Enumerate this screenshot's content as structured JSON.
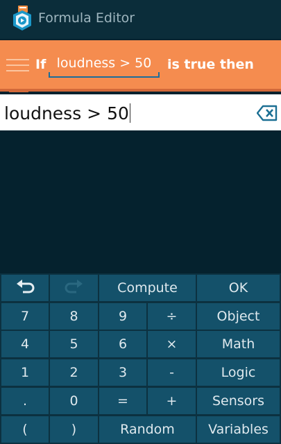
{
  "app": {
    "title": "Formula Editor"
  },
  "brick": {
    "prefix": "If",
    "formula": "loudness > 50",
    "suffix": "is true then"
  },
  "input": {
    "value": "loudness > 50"
  },
  "keys": {
    "compute": "Compute",
    "ok": "OK",
    "n7": "7",
    "n8": "8",
    "n9": "9",
    "divide": "÷",
    "object": "Object",
    "n4": "4",
    "n5": "5",
    "n6": "6",
    "multiply": "×",
    "math": "Math",
    "n1": "1",
    "n2": "2",
    "n3": "3",
    "minus": "-",
    "logic": "Logic",
    "dot": ".",
    "n0": "0",
    "equals": "=",
    "plus": "+",
    "sensors": "Sensors",
    "lparen": "(",
    "rparen": ")",
    "random": "Random",
    "variables": "Variables"
  },
  "icons": {
    "undo": "undo-icon",
    "redo": "redo-icon",
    "backspace": "backspace-icon",
    "app": "app-icon"
  },
  "colors": {
    "brick": "#f58c4f",
    "key": "#14516a",
    "background": "#05222e"
  }
}
